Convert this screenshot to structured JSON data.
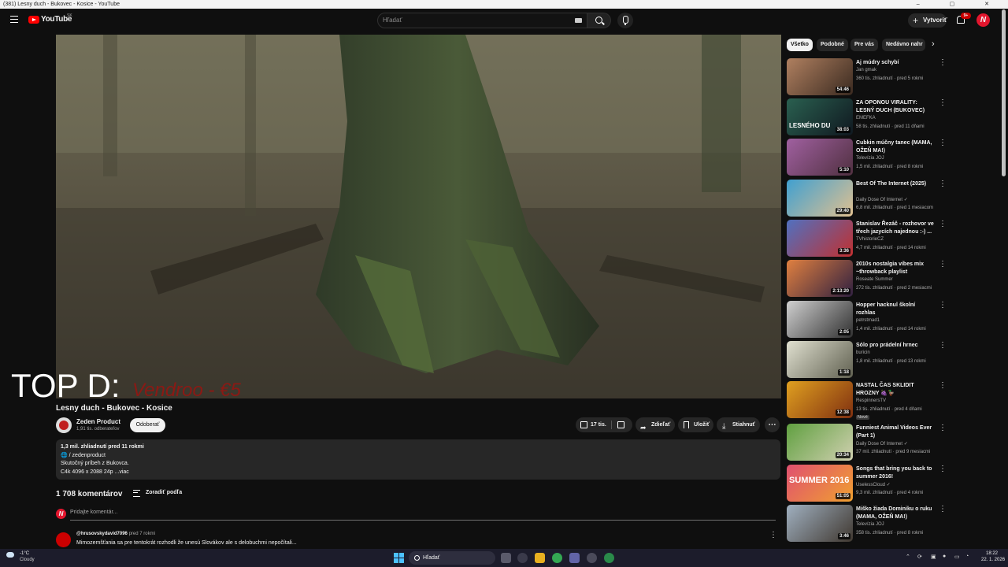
{
  "window": {
    "title": "(381) Lesny duch - Bukovec - Kosice - YouTube",
    "controls": "– ▢ ✕"
  },
  "header": {
    "logo_text": "YouTube",
    "region": "SK",
    "search_placeholder": "Hľadať",
    "create_label": "Vytvoriť",
    "notif_count": "9+",
    "avatar_letter": "N"
  },
  "video": {
    "overlay_text": "TOP D:",
    "overlay_red": "Vendroo - €5",
    "title": "Lesny duch - Bukovec - Kosice",
    "channel": {
      "name": "Zeden Product",
      "subs": "1,91 tis. odberateľov",
      "subscribe_label": "Odoberať"
    },
    "actions": {
      "likes": "17 tis.",
      "share": "Zdieľať",
      "save": "Uložiť",
      "download": "Stiahnuť",
      "more": "⋯"
    },
    "description": {
      "stats": "1,3 mil. zhliadnutí  pred 11 rokmi",
      "line1": "🌐 / zedenproduct",
      "line2": "Skutočný príbeh z Bukovca.",
      "line3": "C4k 4096 x 2088 24p ...viac"
    }
  },
  "comments": {
    "count": "1 708 komentárov",
    "sort_label": "Zoradiť podľa",
    "add_placeholder": "Pridajte komentár...",
    "my_avatar": "N",
    "first": {
      "author": "@hrusovskydavid7096",
      "time": "pred 7 rokmi",
      "text": "Mimozemšťania sa pre tentokrát rozhodli že unesú Slovákov ale s delobuchmi nepočítali..."
    }
  },
  "chips": [
    "Všetko",
    "Podobné",
    "Pre vás",
    "Nedávno nahr"
  ],
  "recommendations": [
    {
      "title": "Aj múdry schybí",
      "channel": "Jan gmak",
      "meta": "360 tis. zhliadnutí · pred 5 rokmi",
      "duration": "54:46",
      "colors": [
        "#b08060",
        "#3a2a20"
      ]
    },
    {
      "title": "ZA OPONOU VIRALITY: LESNÝ DUCH (BUKOVEC)",
      "channel": "EMEFKA",
      "meta": "58 tis. zhliadnutí · pred 11 dňami",
      "duration": "38:03",
      "thumb_text": "LESNÉHO DU",
      "colors": [
        "#2a6050",
        "#101820"
      ]
    },
    {
      "title": "Cubkin múčny tanec (MAMA, OŽEŇ MA!)",
      "channel": "Televízia JOJ",
      "meta": "1,5 mil. zhliadnutí · pred 8 rokmi",
      "duration": "5:10",
      "colors": [
        "#a060a0",
        "#503040"
      ]
    },
    {
      "title": "Best Of The Internet (2025)",
      "channel": "Daily Dose Of Internet ✓",
      "meta": "6,8 mil. zhliadnutí · pred 1 mesiacom",
      "duration": "29:40",
      "colors": [
        "#40a0d0",
        "#e0c090"
      ]
    },
    {
      "title": "Stanislav Řezáč - rozhovor ve třech jazycích najednou :-) ...",
      "channel": "TVhistorieCZ",
      "meta": "4,7 mil. zhliadnutí · pred 14 rokmi",
      "duration": "3:36",
      "colors": [
        "#5070c0",
        "#c03030"
      ]
    },
    {
      "title": "2010s nostalgia vibes mix ~throwback playlist",
      "channel": "Roseate Summer",
      "meta": "272 tis. zhliadnutí · pred 2 mesiacmi",
      "duration": "2:13:20",
      "colors": [
        "#e08040",
        "#302040"
      ]
    },
    {
      "title": "Hopper hacknul školní rozhlas",
      "channel": "petrstmad1",
      "meta": "1,4 mil. zhliadnutí · pred 14 rokmi",
      "duration": "2:05",
      "colors": [
        "#d0d0d0",
        "#303030"
      ]
    },
    {
      "title": "Sólo pro prádelní hrnec",
      "channel": "buricin",
      "meta": "1,8 mil. zhliadnutí · pred 13 rokmi",
      "duration": "1:18",
      "colors": [
        "#e0e0d0",
        "#606050"
      ]
    },
    {
      "title": "NASTAL ČAS SKLIDIT HROZNY 🍇🦆",
      "channel": "RespinnersTV",
      "meta": "13 tis. zhliadnutí · pred 4 dňami",
      "duration": "12:38",
      "new": "Nové",
      "colors": [
        "#e0a020",
        "#803010"
      ]
    },
    {
      "title": "Funniest Animal Videos Ever (Part 1)",
      "channel": "Daily Dose Of Internet ✓",
      "meta": "37 mil. zhliadnutí · pred 9 mesiacmi",
      "duration": "20:34",
      "colors": [
        "#60a040",
        "#d0d0b0"
      ]
    },
    {
      "title": "Songs that bring you back to summer 2016!",
      "channel": "UselessCloud ✓",
      "meta": "9,3 mil. zhliadnutí · pred 4 rokmi",
      "duration": "51:05",
      "thumb_text": "SUMMER 2016",
      "colors": [
        "#e05070",
        "#f0a030"
      ]
    },
    {
      "title": "Miško žiada Dominiku o ruku (MAMA, OŽEŇ MA!)",
      "channel": "Televízia JOJ",
      "meta": "358 tis. zhliadnutí · pred 8 rokmi",
      "duration": "3:46",
      "colors": [
        "#a0b0c0",
        "#403830"
      ]
    }
  ],
  "taskbar": {
    "weather_temp": "-1°C",
    "weather_desc": "Cloudy",
    "search_label": "Hľadať",
    "time": "18:22",
    "date": "22. 1. 2026"
  }
}
